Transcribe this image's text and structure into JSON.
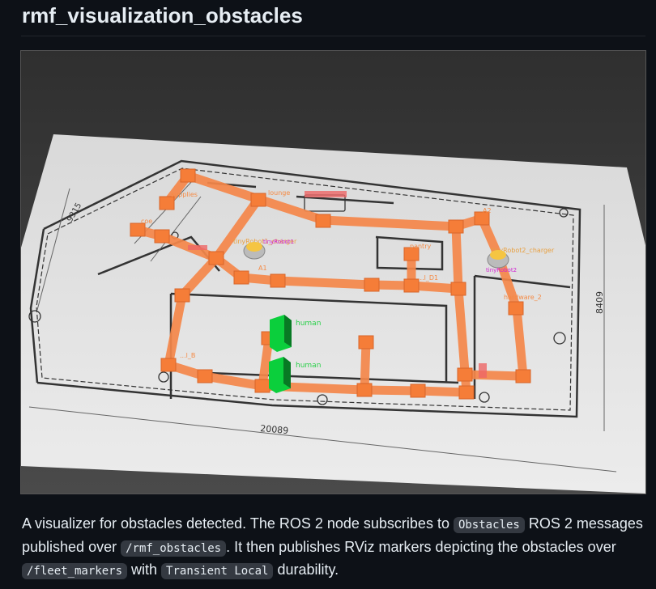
{
  "page": {
    "title": "rmf_visualization_obstacles"
  },
  "figure": {
    "caption_markers": {
      "obstacle_label_1": "human",
      "obstacle_label_2": "human",
      "robot_1": "tinyRobot1",
      "robot_2": "tinyRobot2",
      "charger_1": "tinyRobot1_charger",
      "charger_2": "tinyRobot2_charger",
      "waypoint_pantry": "pantry",
      "waypoint_lounge": "lounge",
      "waypoint_supplies": "supplies",
      "waypoint_hardware": "hardware_2",
      "waypoint_coe": "coe",
      "waypoint_a1": "A1",
      "waypoint_a2": "A2",
      "waypoint_b": "...l_B",
      "waypoint_d1": "...l_D1",
      "dim_horizontal": "20089",
      "dim_vertical": "8409",
      "dim_left": "9315"
    },
    "colors": {
      "lane": "#f5874a",
      "node": "#f57d38",
      "obstacle": "#0bcf3c",
      "floor": "#e3e3e3",
      "background": "#3a3a3a"
    }
  },
  "description": {
    "part1": "A visualizer for obstacles detected. The ROS 2 node subscribes to ",
    "code1": "Obstacles",
    "part2": " ROS 2 messages published over ",
    "code2": "/rmf_obstacles",
    "part3": ". It then publishes RViz markers depicting the obstacles over ",
    "code3": "/fleet_markers",
    "part4": " with ",
    "code4": "Transient Local",
    "part5": " durability."
  }
}
